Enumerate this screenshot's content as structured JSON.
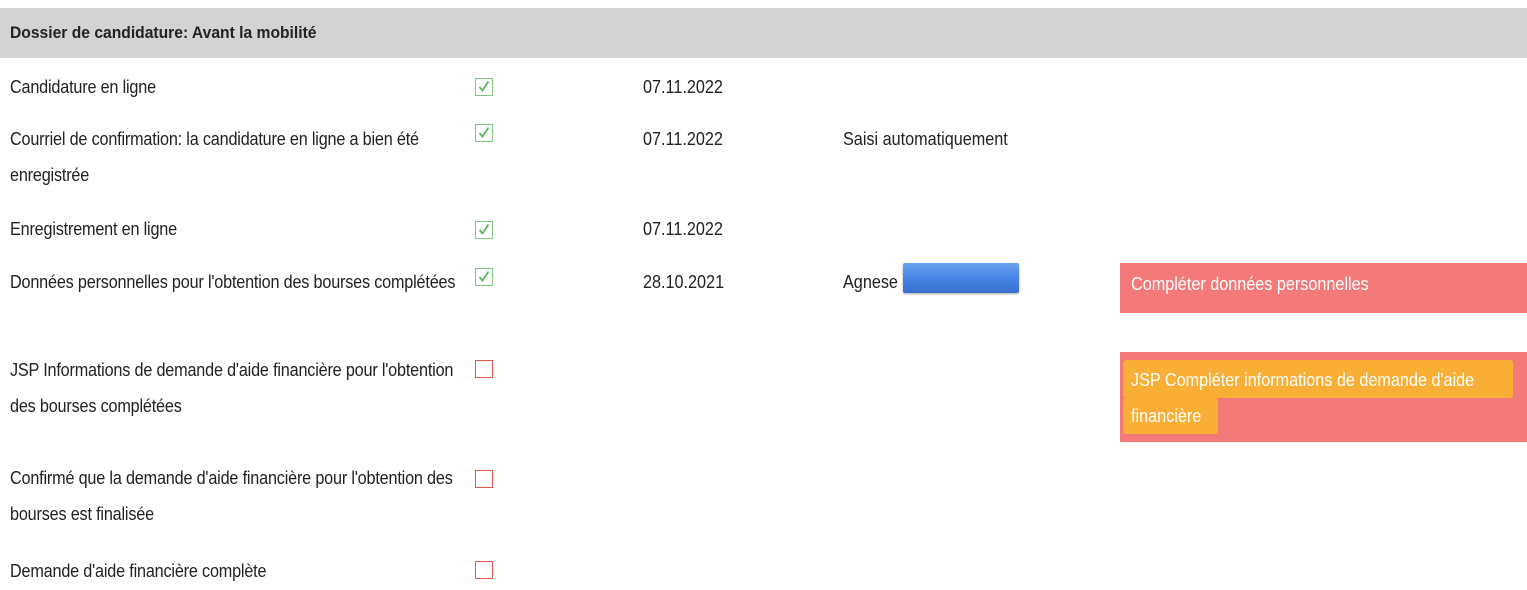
{
  "section": {
    "title": "Dossier de candidature: Avant la mobilité"
  },
  "rows": [
    {
      "label": "Candidature en ligne",
      "checked": true,
      "date": "07.11.2022",
      "note": ""
    },
    {
      "label": "Courriel de confirmation: la candidature en ligne a bien été enregistrée",
      "checked": true,
      "date": "07.11.2022",
      "note": "Saisi automatiquement"
    },
    {
      "label": "Enregistrement en ligne",
      "checked": true,
      "date": "07.11.2022",
      "note": ""
    },
    {
      "label": "Données personnelles pour l'obtention des bourses complétées",
      "checked": true,
      "date": "28.10.2021",
      "note": "Agnese",
      "action": "Compléter données personnelles"
    },
    {
      "label": "JSP Informations de demande d'aide financière pour l'obtention des bourses complétées",
      "checked": false,
      "date": "",
      "note": "",
      "action": "JSP Compléter informations de demande d'aide financière"
    },
    {
      "label": "Confirmé que la demande d'aide financière pour l'obtention des bourses est finalisée",
      "checked": false,
      "date": "",
      "note": ""
    },
    {
      "label": "Demande d'aide financière complète",
      "checked": false,
      "date": "",
      "note": ""
    }
  ],
  "colors": {
    "header_bg": "#d3d3d3",
    "action_bg": "#f47a7a",
    "highlight": "#f9b233",
    "check_green": "#5cb85c",
    "unchecked_border": "#e05a4e",
    "redaction_blue": "#4682e6"
  }
}
